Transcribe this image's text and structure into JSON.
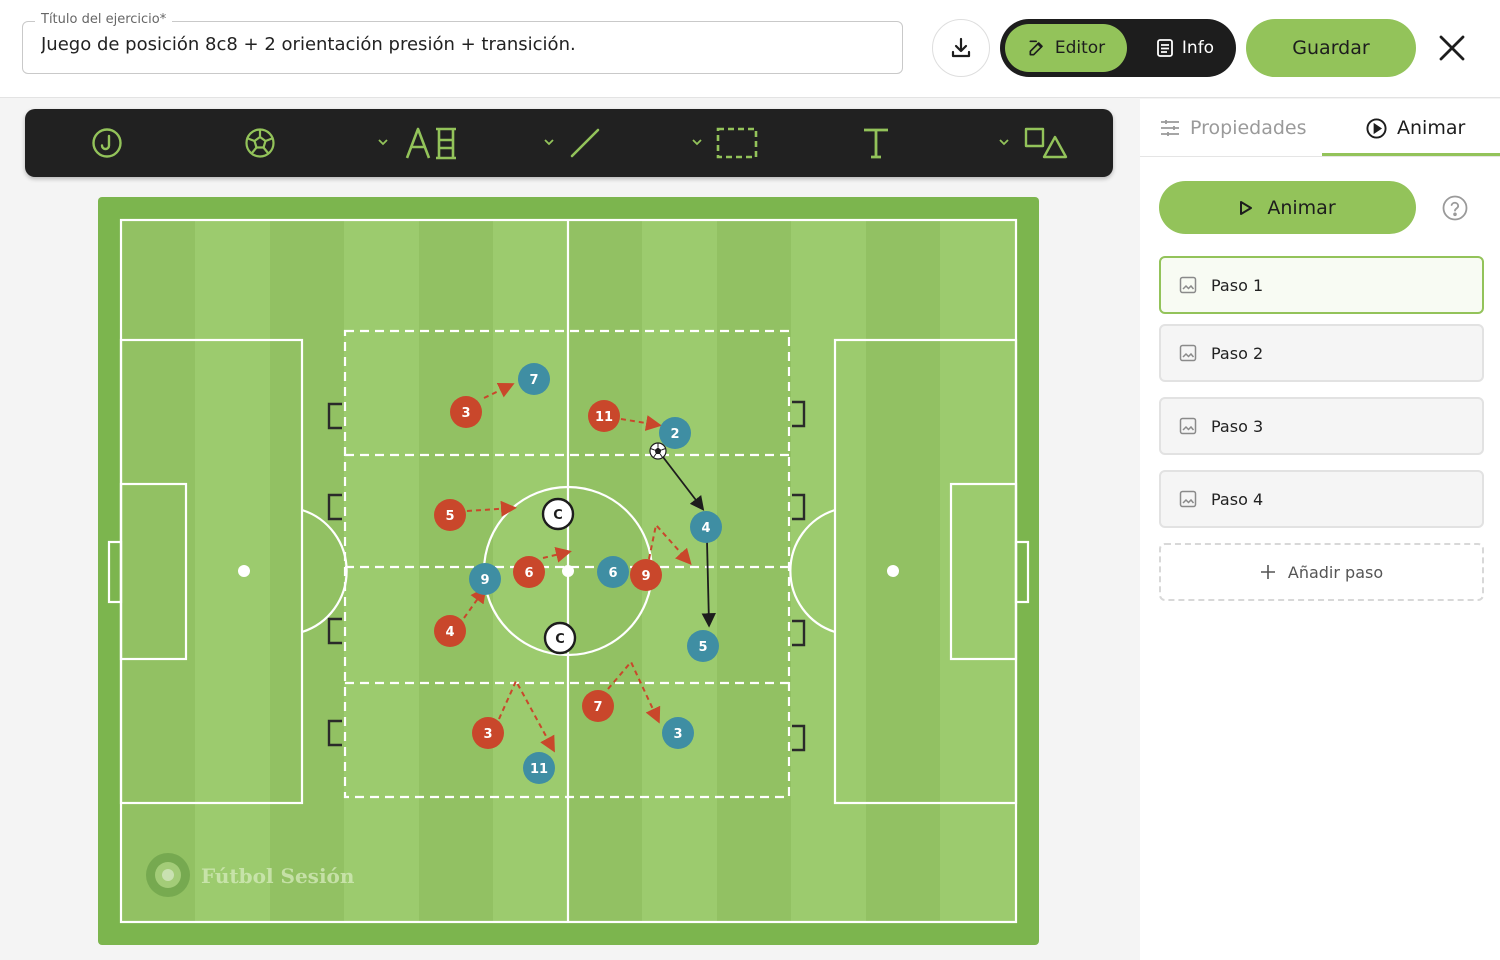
{
  "header": {
    "title_label": "Título del ejercicio*",
    "title_value": "Juego de posición 8c8 + 2 orientación presión + transición.",
    "editor_label": "Editor",
    "info_label": "Info",
    "save_label": "Guardar"
  },
  "toolbar": {
    "tools": [
      "player-tool",
      "ball-tool",
      "text-player-tool",
      "line-tool",
      "area-tool",
      "text-tool",
      "shapes-tool"
    ]
  },
  "field": {
    "watermark": "Fútbol Sesión",
    "colors": {
      "red": "#c9472b",
      "blue": "#3f8ea3",
      "pitch_light": "#9ccb6e",
      "pitch_dark": "#8fbf61",
      "border": "#7cb54e"
    },
    "red_players": [
      "3",
      "11",
      "5",
      "6",
      "9",
      "4",
      "3",
      "7"
    ],
    "blue_players": [
      "7",
      "2",
      "4",
      "9",
      "6",
      "5",
      "11",
      "3"
    ],
    "neutral_players": [
      "C",
      "C"
    ]
  },
  "panel": {
    "tab_properties": "Propiedades",
    "tab_animate": "Animar",
    "animate_button": "Animar",
    "steps": [
      "Paso 1",
      "Paso 2",
      "Paso 3",
      "Paso 4"
    ],
    "add_step": "Añadir paso",
    "active_step": 1
  }
}
